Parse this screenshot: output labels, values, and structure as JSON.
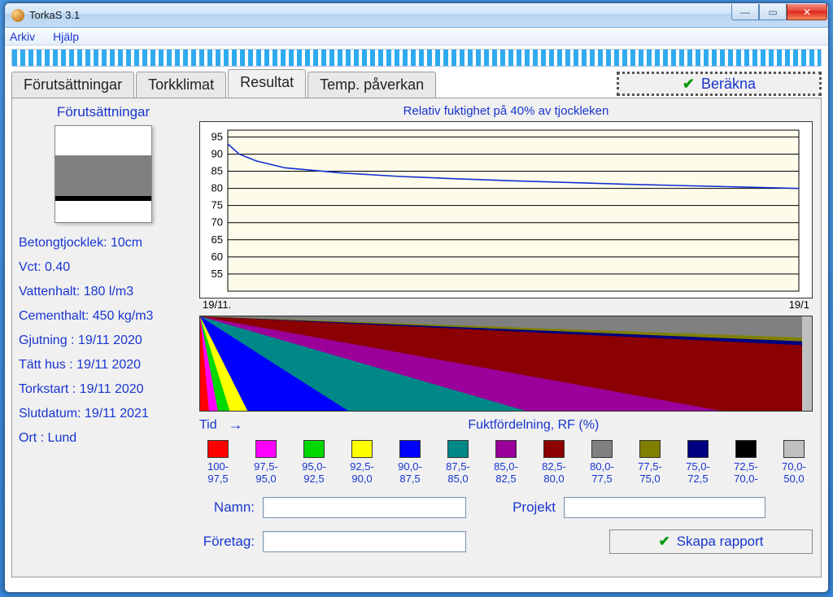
{
  "window": {
    "title": "TorkaS 3.1"
  },
  "menu": {
    "file": "Arkiv",
    "help": "Hjälp"
  },
  "tabs": {
    "t1": "Förutsättningar",
    "t2": "Torkklimat",
    "t3": "Resultat",
    "t4": "Temp. påverkan"
  },
  "calc_button": "Beräkna",
  "sidebar": {
    "title": "Förutsättningar",
    "thickness": "Betongtjocklek: 10cm",
    "vct": "Vct: 0.40",
    "water": "Vattenhalt: 180 l/m3",
    "cement": "Cementhalt: 450 kg/m3",
    "casting": "Gjutning  : 19/11 2020",
    "tight": "Tätt hus  : 19/11 2020",
    "drystart": "Torkstart : 19/11 2020",
    "enddate": "Slutdatum: 19/11 2021",
    "ort": "Ort     : Lund"
  },
  "chart_data": {
    "type": "line",
    "title": "Relativ fuktighet på 40% av tjockleken",
    "ylabel": "",
    "xlabel": "",
    "ylim": [
      50,
      97
    ],
    "y_ticks": [
      55,
      60,
      65,
      70,
      75,
      80,
      85,
      90,
      95
    ],
    "x_start_label": "19/11.",
    "x_end_label": "19/1",
    "series": [
      {
        "name": "RF",
        "points": [
          [
            0,
            93
          ],
          [
            0.02,
            90
          ],
          [
            0.05,
            88
          ],
          [
            0.1,
            86
          ],
          [
            0.2,
            84.5
          ],
          [
            0.3,
            83.5
          ],
          [
            0.4,
            82.8
          ],
          [
            0.5,
            82.2
          ],
          [
            0.6,
            81.7
          ],
          [
            0.7,
            81.2
          ],
          [
            0.8,
            80.8
          ],
          [
            0.9,
            80.4
          ],
          [
            1.0,
            80
          ]
        ]
      }
    ]
  },
  "heatmap": {
    "tid_label": "Tid",
    "title": "Fuktfördelning, RF (%)"
  },
  "legend": [
    {
      "color": "#ff0000",
      "label": "100-\n97,5"
    },
    {
      "color": "#ff00ff",
      "label": "97,5-\n95,0"
    },
    {
      "color": "#00d800",
      "label": "95,0-\n92,5"
    },
    {
      "color": "#ffff00",
      "label": "92,5-\n90,0"
    },
    {
      "color": "#0000ff",
      "label": "90,0-\n87,5"
    },
    {
      "color": "#008888",
      "label": "87,5-\n85,0"
    },
    {
      "color": "#9b009b",
      "label": "85,0-\n82,5"
    },
    {
      "color": "#8b0000",
      "label": "82,5-\n80,0"
    },
    {
      "color": "#808080",
      "label": "80,0-\n77,5"
    },
    {
      "color": "#808000",
      "label": "77,5-\n75,0"
    },
    {
      "color": "#000080",
      "label": "75,0-\n72,5"
    },
    {
      "color": "#000000",
      "label": "72,5-\n70,0-"
    },
    {
      "color": "#c0c0c0",
      "label": "70,0-\n50,0"
    }
  ],
  "form": {
    "name_label": "Namn:",
    "project_label": "Projekt",
    "company_label": "Företag:",
    "report_button": "Skapa rapport",
    "name_value": "",
    "project_value": "",
    "company_value": ""
  }
}
